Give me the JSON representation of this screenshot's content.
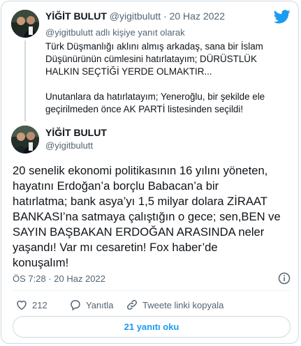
{
  "reply_tweet": {
    "name": "YİĞİT BULUT",
    "handle": "@yigitbulutt",
    "separator": "·",
    "date": "20 Haz 2022",
    "reply_to": "@yigitbulutt adlı kişiye yanıt olarak",
    "paragraph1": "Türk Düşmanlığı aklını almış arkadaş, sana bir İslam Düşünürünün cümlesini hatırlatayım; DÜRÜSTLÜK HALKIN SEÇTİĞİ YERDE OLMAKTIR...",
    "paragraph2": "Unutanlara da hatırlatayım; Yeneroğlu, bir şekilde ele geçirilmeden önce AK PARTİ listesinden seçildi!"
  },
  "main_tweet": {
    "name": "YİĞİT BULUT",
    "handle": "@yigitbulutt",
    "text": "20 senelik ekonomi politikasının 16 yılını yöneten,\nhayatını Erdoğan’a borçlu Babacan’a bir\nhatırlatma; bank asya’yı 1,5 milyar dolara ZİRAAT\nBANKASI’na satmaya çalıştığın o gece; sen,BEN ve\nSAYIN BAŞBAKAN ERDOĞAN ARASINDA neler\nyaşandı! Var mı cesaretin! Fox haber’de\nkonuşalım!",
    "timestamp": "ÖS 7:28 · 20 Haz 2022"
  },
  "actions": {
    "like_count": "212",
    "reply_label": "Yanıtla",
    "copy_link_label": "Tweete linki kopyala"
  },
  "replies_button": "21 yanıtı oku",
  "colors": {
    "accent": "#1d9bf0",
    "like": "#f91880",
    "muted": "#536471",
    "border": "#cfd9de"
  },
  "icons": [
    "twitter-bird-icon",
    "info-icon",
    "heart-icon",
    "reply-icon",
    "link-icon"
  ]
}
